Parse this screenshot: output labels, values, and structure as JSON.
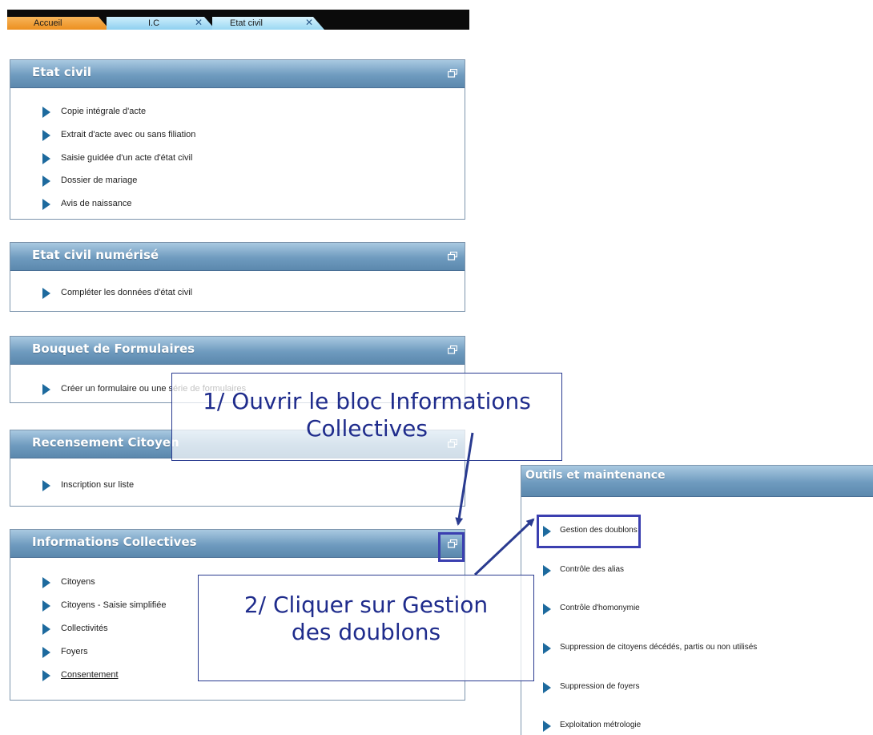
{
  "tabs": [
    {
      "label": "Accueil",
      "active": false
    },
    {
      "label": "I.C",
      "close": "✕"
    },
    {
      "label": "Etat civil",
      "close": "✕"
    }
  ],
  "panels": {
    "etat_civil": {
      "title": "Etat civil",
      "items": [
        "Copie intégrale d'acte",
        "Extrait d'acte avec ou sans filiation",
        "Saisie guidée d'un acte d'état civil",
        "Dossier de mariage",
        "Avis de naissance"
      ]
    },
    "etat_civil_numerise": {
      "title": "Etat civil numérisé",
      "items": [
        "Compléter les données d'état civil"
      ]
    },
    "bouquet": {
      "title": "Bouquet de Formulaires",
      "items": [
        "Créer un formulaire ou une série de formulaires"
      ]
    },
    "recensement": {
      "title": "Recensement Citoyen",
      "items": [
        "Inscription sur liste"
      ]
    },
    "informations_collectives": {
      "title": "Informations Collectives",
      "items": [
        "Citoyens",
        "Citoyens - Saisie simplifiée",
        "Collectivités",
        "Foyers",
        "Consentement"
      ]
    },
    "outils": {
      "title": "Outils et maintenance",
      "items": [
        "Gestion des doublons",
        "Contrôle des alias",
        "Contrôle d'homonymie",
        "Suppression de citoyens décédés, partis ou non utilisés",
        "Suppression de foyers",
        "Exploitation métrologie"
      ]
    }
  },
  "callouts": {
    "step1": {
      "line1": "1/ Ouvrir le bloc Informations",
      "line2": "Collectives"
    },
    "step2": {
      "line1": "2/ Cliquer sur Gestion",
      "line2": "des doublons"
    }
  },
  "colors": {
    "header_gradient_top": "#a9c9e1",
    "header_gradient_bottom": "#5b88ad",
    "accent_arrow": "#1d6a9e",
    "annotation": "#2a3b90",
    "tab_home": "#ec8f1f",
    "tab_open": "#8ed0f0"
  },
  "icons": {
    "panel_button": "window-restore-icon",
    "item_bullet": "triangle-right-icon",
    "tab_close": "close-icon"
  }
}
